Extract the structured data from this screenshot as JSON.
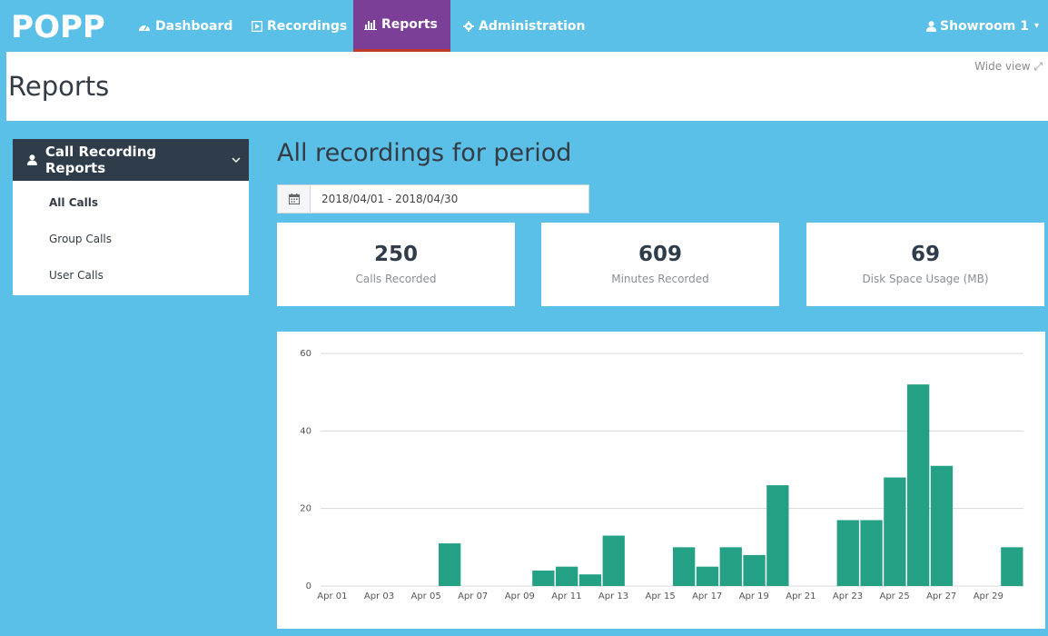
{
  "nav": {
    "logo_text": "POPP",
    "items": [
      {
        "label": "Dashboard",
        "icon": "dashboard-icon"
      },
      {
        "label": "Recordings",
        "icon": "play-square-icon"
      },
      {
        "label": "Reports",
        "icon": "bar-chart-icon"
      },
      {
        "label": "Administration",
        "icon": "gear-icon"
      }
    ],
    "active_item": "Reports",
    "user_label": "Showroom 1",
    "accent_active": "#7b3f98"
  },
  "header": {
    "title": "Reports",
    "wide_view_label": "Wide view"
  },
  "sidebar": {
    "section_label": "Call Recording Reports",
    "items": [
      {
        "label": "All Calls"
      },
      {
        "label": "Group Calls"
      },
      {
        "label": "User Calls"
      }
    ],
    "active_item": "All Calls"
  },
  "main": {
    "title": "All recordings for period",
    "date_range": "2018/04/01 - 2018/04/30",
    "stats": [
      {
        "value": "250",
        "label": "Calls Recorded"
      },
      {
        "value": "609",
        "label": "Minutes Recorded"
      },
      {
        "value": "69",
        "label": "Disk Space Usage (MB)"
      }
    ]
  },
  "colors": {
    "background": "#5bc0e8",
    "sidebar_header": "#2f3d4a",
    "bar": "#24a085"
  },
  "chart_data": {
    "type": "bar",
    "categories": [
      "Apr 01",
      "Apr 02",
      "Apr 03",
      "Apr 04",
      "Apr 05",
      "Apr 06",
      "Apr 07",
      "Apr 08",
      "Apr 09",
      "Apr 10",
      "Apr 11",
      "Apr 12",
      "Apr 13",
      "Apr 14",
      "Apr 15",
      "Apr 16",
      "Apr 17",
      "Apr 18",
      "Apr 19",
      "Apr 20",
      "Apr 21",
      "Apr 22",
      "Apr 23",
      "Apr 24",
      "Apr 25",
      "Apr 26",
      "Apr 27",
      "Apr 28",
      "Apr 29",
      "Apr 30"
    ],
    "tick_labels": [
      "Apr 01",
      "Apr 03",
      "Apr 05",
      "Apr 07",
      "Apr 09",
      "Apr 11",
      "Apr 13",
      "Apr 15",
      "Apr 17",
      "Apr 19",
      "Apr 21",
      "Apr 23",
      "Apr 25",
      "Apr 27",
      "Apr 29"
    ],
    "values": [
      0,
      0,
      0,
      0,
      0,
      11,
      0,
      0,
      0,
      4,
      5,
      3,
      13,
      0,
      0,
      10,
      5,
      10,
      8,
      26,
      0,
      0,
      17,
      17,
      28,
      52,
      31,
      0,
      0,
      10
    ],
    "ylim": [
      0,
      60
    ],
    "yticks": [
      0,
      20,
      40,
      60
    ],
    "grid": true,
    "legend": "none"
  }
}
